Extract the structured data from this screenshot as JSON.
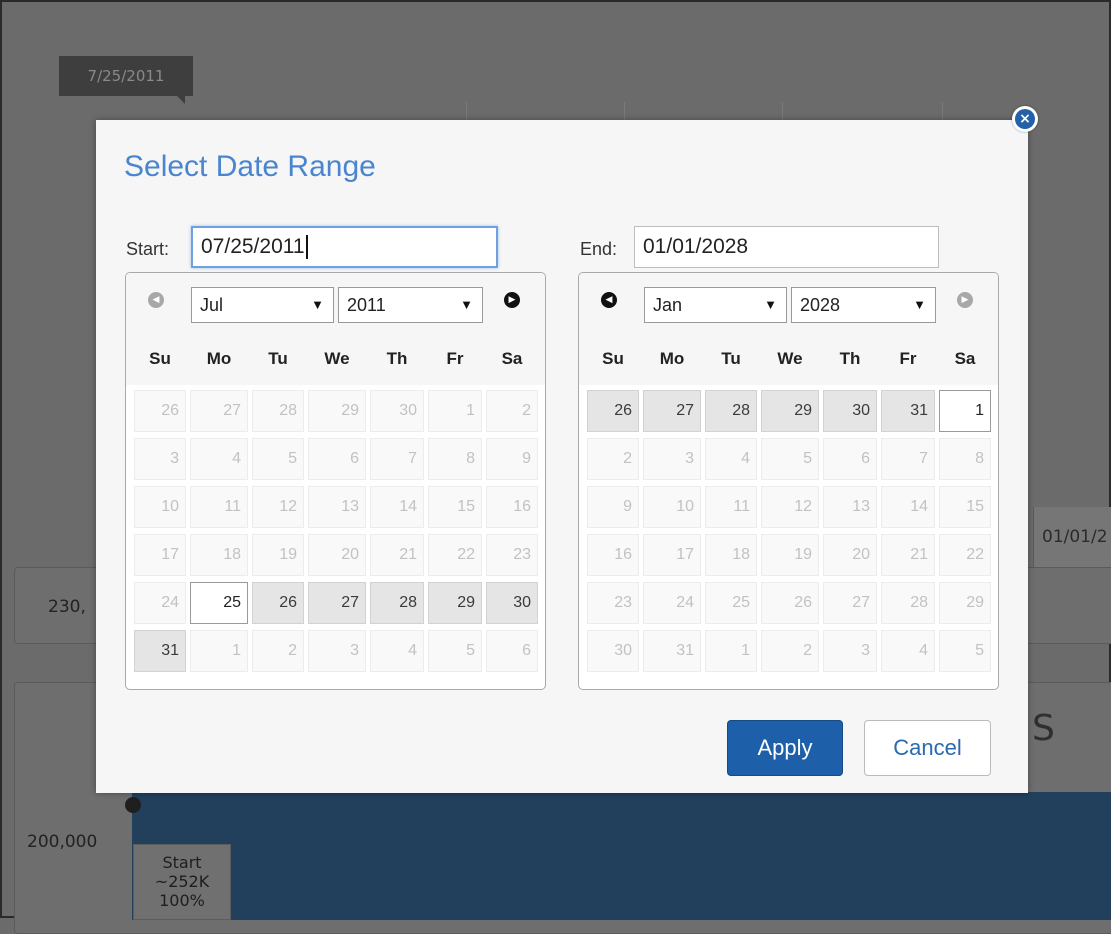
{
  "background": {
    "date_flag": "7/25/2011",
    "value_label_1": "230,",
    "value_label_2": "200,000",
    "end_label": "01/01/2",
    "start_card": {
      "line1": "Start",
      "line2": "~252K",
      "line3": "100%"
    },
    "partial_heading": "S"
  },
  "dialog": {
    "title": "Select Date Range",
    "close_icon": "close-circle-icon",
    "start": {
      "label": "Start:",
      "value": "07/25/2011",
      "month": "Jul",
      "year": "2011",
      "prev_enabled": false,
      "next_enabled": true
    },
    "end": {
      "label": "End:",
      "value": "01/01/2028",
      "month": "Jan",
      "year": "2028",
      "prev_enabled": true,
      "next_enabled": false
    },
    "weekdays": [
      "Su",
      "Mo",
      "Tu",
      "We",
      "Th",
      "Fr",
      "Sa"
    ],
    "start_calendar": [
      [
        "26",
        "27",
        "28",
        "29",
        "30",
        "1",
        "2"
      ],
      [
        "3",
        "4",
        "5",
        "6",
        "7",
        "8",
        "9"
      ],
      [
        "10",
        "11",
        "12",
        "13",
        "14",
        "15",
        "16"
      ],
      [
        "17",
        "18",
        "19",
        "20",
        "21",
        "22",
        "23"
      ],
      [
        "24",
        "25",
        "26",
        "27",
        "28",
        "29",
        "30"
      ],
      [
        "31",
        "1",
        "2",
        "3",
        "4",
        "5",
        "6"
      ]
    ],
    "start_states": [
      [
        "d",
        "d",
        "d",
        "d",
        "d",
        "d",
        "d"
      ],
      [
        "d",
        "d",
        "d",
        "d",
        "d",
        "d",
        "d"
      ],
      [
        "d",
        "d",
        "d",
        "d",
        "d",
        "d",
        "d"
      ],
      [
        "d",
        "d",
        "d",
        "d",
        "d",
        "d",
        "d"
      ],
      [
        "d",
        "s",
        "a",
        "a",
        "a",
        "a",
        "a"
      ],
      [
        "a",
        "d",
        "d",
        "d",
        "d",
        "d",
        "d"
      ]
    ],
    "end_calendar": [
      [
        "26",
        "27",
        "28",
        "29",
        "30",
        "31",
        "1"
      ],
      [
        "2",
        "3",
        "4",
        "5",
        "6",
        "7",
        "8"
      ],
      [
        "9",
        "10",
        "11",
        "12",
        "13",
        "14",
        "15"
      ],
      [
        "16",
        "17",
        "18",
        "19",
        "20",
        "21",
        "22"
      ],
      [
        "23",
        "24",
        "25",
        "26",
        "27",
        "28",
        "29"
      ],
      [
        "30",
        "31",
        "1",
        "2",
        "3",
        "4",
        "5"
      ]
    ],
    "end_states": [
      [
        "a",
        "a",
        "a",
        "a",
        "a",
        "a",
        "s"
      ],
      [
        "d",
        "d",
        "d",
        "d",
        "d",
        "d",
        "d"
      ],
      [
        "d",
        "d",
        "d",
        "d",
        "d",
        "d",
        "d"
      ],
      [
        "d",
        "d",
        "d",
        "d",
        "d",
        "d",
        "d"
      ],
      [
        "d",
        "d",
        "d",
        "d",
        "d",
        "d",
        "d"
      ],
      [
        "d",
        "d",
        "d",
        "d",
        "d",
        "d",
        "d"
      ]
    ],
    "apply_label": "Apply",
    "cancel_label": "Cancel"
  },
  "colors": {
    "title": "#4a86cf",
    "apply_bg": "#1d5fa8",
    "cancel_text": "#2a6ab0",
    "overlay": "#6b6b6b"
  }
}
